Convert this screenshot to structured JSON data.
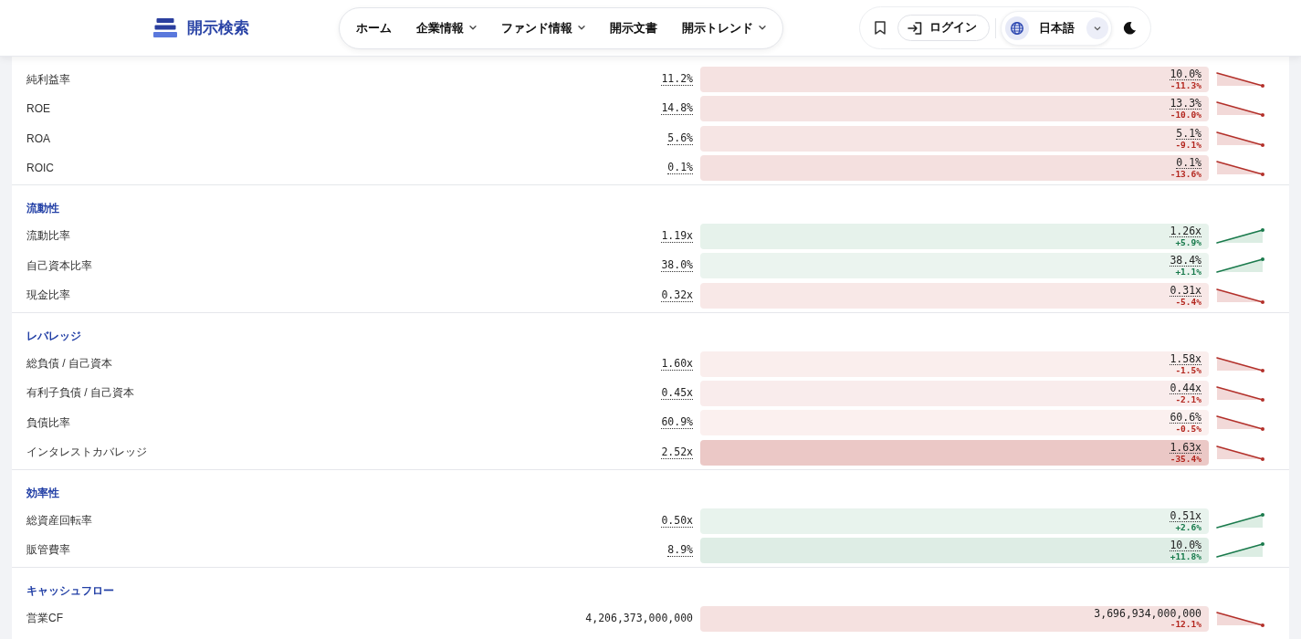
{
  "header": {
    "logo_text": "開示検索",
    "nav": [
      {
        "label": "ホーム",
        "has_menu": false
      },
      {
        "label": "企業情報",
        "has_menu": true
      },
      {
        "label": "ファンド情報",
        "has_menu": true
      },
      {
        "label": "開示文書",
        "has_menu": false
      },
      {
        "label": "開示トレンド",
        "has_menu": true
      }
    ],
    "login_label": "ログイン",
    "language": "日本語"
  },
  "sections": [
    {
      "rows": [
        {
          "label": "純利益率",
          "kind": "ratio",
          "current": "11.2%",
          "compare": "10.0%",
          "change": "-11.3%",
          "negative": true,
          "color": "#f5e2e1"
        },
        {
          "label": "ROE",
          "kind": "ratio",
          "current": "14.8%",
          "compare": "13.3%",
          "change": "-10.0%",
          "negative": true,
          "color": "#f5e3e2"
        },
        {
          "label": "ROA",
          "kind": "ratio",
          "current": "5.6%",
          "compare": "5.1%",
          "change": "-9.1%",
          "negative": true,
          "color": "#f6e5e4"
        },
        {
          "label": "ROIC",
          "kind": "ratio",
          "current": "0.1%",
          "compare": "0.1%",
          "change": "-13.6%",
          "negative": true,
          "color": "#f4e0df"
        }
      ]
    },
    {
      "title": "流動性",
      "rows": [
        {
          "label": "流動比率",
          "kind": "ratio",
          "current": "1.19x",
          "compare": "1.26x",
          "change": "+5.9%",
          "negative": false,
          "color": "#e6f2eb"
        },
        {
          "label": "自己資本比率",
          "kind": "ratio",
          "current": "38.0%",
          "compare": "38.4%",
          "change": "+1.1%",
          "negative": false,
          "color": "#ebf4ef"
        },
        {
          "label": "現金比率",
          "kind": "ratio",
          "current": "0.32x",
          "compare": "0.31x",
          "change": "-5.4%",
          "negative": true,
          "color": "#f8e8e7"
        }
      ]
    },
    {
      "title": "レバレッジ",
      "rows": [
        {
          "label": "総負債 / 自己資本",
          "kind": "ratio",
          "current": "1.60x",
          "compare": "1.58x",
          "change": "-1.5%",
          "negative": true,
          "color": "#faeeed"
        },
        {
          "label": "有利子負債 / 自己資本",
          "kind": "ratio",
          "current": "0.45x",
          "compare": "0.44x",
          "change": "-2.1%",
          "negative": true,
          "color": "#f9ecec"
        },
        {
          "label": "負債比率",
          "kind": "ratio",
          "current": "60.9%",
          "compare": "60.6%",
          "change": "-0.5%",
          "negative": true,
          "color": "#fbf0ef"
        },
        {
          "label": "インタレストカバレッジ",
          "kind": "ratio",
          "current": "2.52x",
          "compare": "1.63x",
          "change": "-35.4%",
          "negative": true,
          "color": "#ebc8c6"
        }
      ]
    },
    {
      "title": "効率性",
      "rows": [
        {
          "label": "総資産回転率",
          "kind": "ratio",
          "current": "0.50x",
          "compare": "0.51x",
          "change": "+2.6%",
          "negative": false,
          "color": "#e8f3ed"
        },
        {
          "label": "販管費率",
          "kind": "ratio",
          "current": "8.9%",
          "compare": "10.0%",
          "change": "+11.8%",
          "negative": false,
          "color": "#deede5"
        }
      ]
    },
    {
      "title": "キャッシュフロー",
      "rows": [
        {
          "label": "営業CF",
          "kind": "amount",
          "current": "4,206,373,000,000",
          "compare": "3,696,934,000,000",
          "change": "-12.1%",
          "negative": true,
          "color": "#f5e1e0"
        }
      ]
    }
  ]
}
